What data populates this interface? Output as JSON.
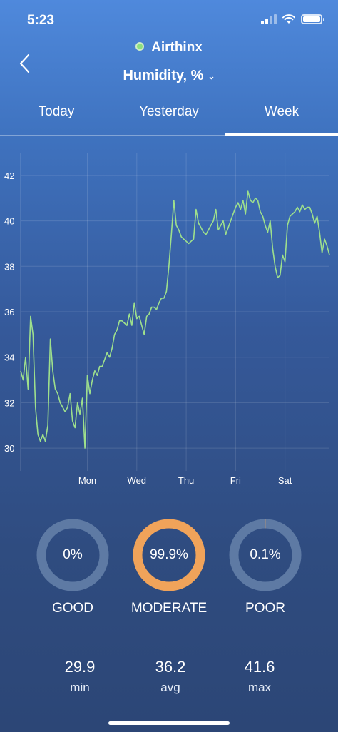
{
  "status_bar": {
    "time": "5:23"
  },
  "header": {
    "device_name": "Airthinx",
    "metric": "Humidity, %"
  },
  "tabs": [
    {
      "label": "Today",
      "active": false
    },
    {
      "label": "Yesterday",
      "active": false
    },
    {
      "label": "Week",
      "active": true
    }
  ],
  "chart_data": {
    "type": "line",
    "title": "",
    "xlabel": "",
    "ylabel": "",
    "ylim": [
      29,
      43
    ],
    "xlim": [
      -1.35,
      4.9
    ],
    "grid": true,
    "yticks": [
      30,
      32,
      34,
      36,
      38,
      40,
      42
    ],
    "x_ticks": [
      {
        "x": 0,
        "label": "Mon"
      },
      {
        "x": 1,
        "label": "Wed"
      },
      {
        "x": 2,
        "label": "Thu"
      },
      {
        "x": 3,
        "label": "Fri"
      },
      {
        "x": 4,
        "label": "Sat"
      }
    ],
    "line_color": "#9ee08c",
    "series": [
      {
        "values_x": [
          -1.35,
          -1.3,
          -1.25,
          -1.2,
          -1.15,
          -1.1,
          -1.05,
          -1.0,
          -0.95,
          -0.9,
          -0.85,
          -0.8,
          -0.75,
          -0.7,
          -0.65,
          -0.6,
          -0.55,
          -0.5,
          -0.45,
          -0.4,
          -0.35,
          -0.3,
          -0.25,
          -0.2,
          -0.15,
          -0.1,
          -0.05,
          0.0,
          0.05,
          0.1,
          0.15,
          0.2,
          0.25,
          0.3,
          0.35,
          0.4,
          0.45,
          0.5,
          0.55,
          0.6,
          0.65,
          0.7,
          0.75,
          0.8,
          0.85,
          0.9,
          0.95,
          1.0,
          1.05,
          1.1,
          1.15,
          1.2,
          1.25,
          1.3,
          1.35,
          1.4,
          1.45,
          1.5,
          1.55,
          1.6,
          1.65,
          1.7,
          1.75,
          1.8,
          1.85,
          1.9,
          1.95,
          2.0,
          2.05,
          2.1,
          2.15,
          2.2,
          2.25,
          2.3,
          2.35,
          2.4,
          2.45,
          2.5,
          2.55,
          2.6,
          2.65,
          2.7,
          2.75,
          2.8,
          2.85,
          2.9,
          2.95,
          3.0,
          3.05,
          3.1,
          3.15,
          3.2,
          3.25,
          3.3,
          3.35,
          3.4,
          3.45,
          3.5,
          3.55,
          3.6,
          3.65,
          3.7,
          3.75,
          3.8,
          3.85,
          3.9,
          3.95,
          4.0,
          4.05,
          4.1,
          4.15,
          4.2,
          4.25,
          4.3,
          4.35,
          4.4,
          4.45,
          4.5,
          4.55,
          4.6,
          4.65,
          4.7,
          4.75,
          4.8,
          4.85,
          4.9
        ],
        "values_y": [
          33.4,
          33.0,
          34.0,
          32.6,
          35.8,
          35.0,
          31.8,
          30.6,
          30.3,
          30.6,
          30.3,
          31.0,
          34.8,
          33.4,
          32.6,
          32.4,
          32.0,
          31.8,
          31.6,
          31.8,
          32.4,
          31.2,
          30.9,
          32.0,
          31.5,
          32.2,
          30.0,
          33.2,
          32.4,
          33.0,
          33.4,
          33.2,
          33.6,
          33.6,
          33.9,
          34.2,
          34.0,
          34.4,
          35.0,
          35.2,
          35.6,
          35.6,
          35.5,
          35.4,
          35.9,
          35.4,
          36.4,
          35.7,
          35.8,
          35.4,
          35.0,
          35.8,
          35.9,
          36.2,
          36.2,
          36.1,
          36.4,
          36.6,
          36.6,
          36.9,
          38.0,
          39.4,
          40.9,
          39.8,
          39.6,
          39.3,
          39.2,
          39.1,
          39.0,
          39.1,
          39.2,
          40.5,
          39.9,
          39.7,
          39.5,
          39.4,
          39.6,
          39.8,
          40.0,
          40.5,
          39.6,
          39.8,
          40.0,
          39.4,
          39.7,
          40.0,
          40.3,
          40.6,
          40.8,
          40.5,
          40.9,
          40.3,
          41.3,
          40.9,
          40.8,
          41.0,
          40.9,
          40.4,
          40.2,
          39.8,
          39.5,
          40.0,
          38.8,
          38.0,
          37.5,
          37.6,
          38.5,
          38.2,
          39.8,
          40.2,
          40.3,
          40.4,
          40.6,
          40.4,
          40.7,
          40.5,
          40.6,
          40.6,
          40.3,
          39.9,
          40.2,
          39.5,
          38.6,
          39.2,
          38.9,
          38.5
        ]
      }
    ]
  },
  "gauges": [
    {
      "percent": "0%",
      "label": "GOOD",
      "fraction": 0.0
    },
    {
      "percent": "99.9%",
      "label": "MODERATE",
      "fraction": 0.999
    },
    {
      "percent": "0.1%",
      "label": "POOR",
      "fraction": 0.001
    }
  ],
  "gauge_colors": {
    "track": "#5e7aa4",
    "active": "#f0a35a"
  },
  "stats": [
    {
      "value": "29.9",
      "label": "min"
    },
    {
      "value": "36.2",
      "label": "avg"
    },
    {
      "value": "41.6",
      "label": "max"
    }
  ]
}
